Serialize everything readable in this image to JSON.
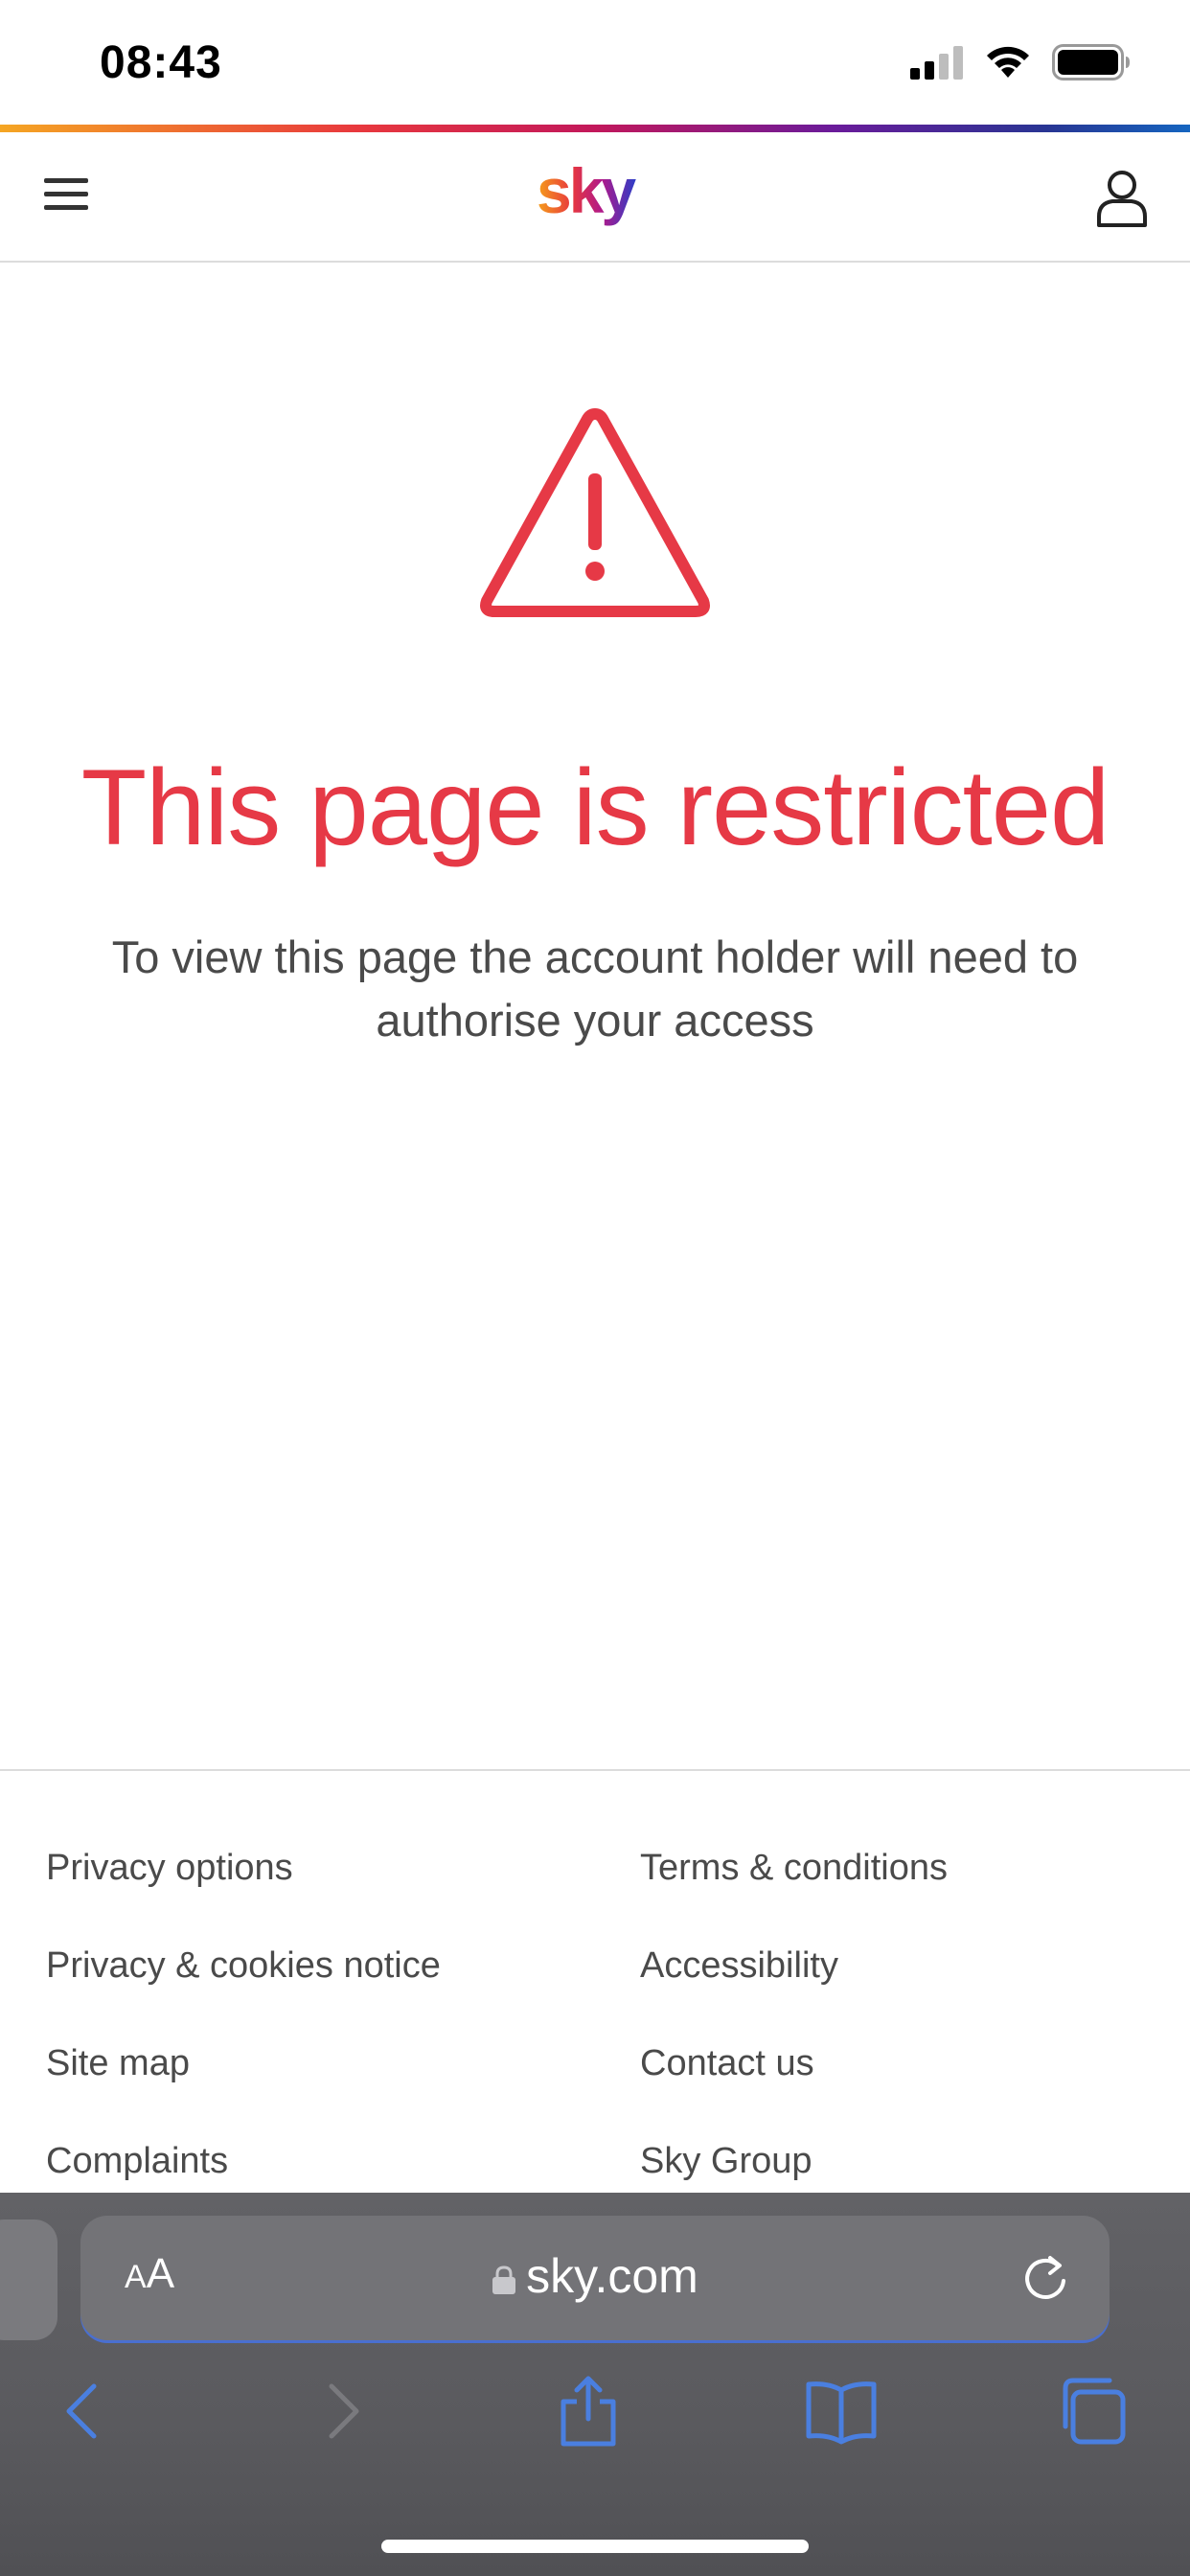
{
  "status_bar": {
    "time": "08:43"
  },
  "header": {
    "logo_text": "sky"
  },
  "main": {
    "title": "This page is restricted",
    "message": "To view this page the account holder will need to authorise your access"
  },
  "footer": {
    "left": [
      "Privacy options",
      "Privacy & cookies notice",
      "Site map",
      "Complaints"
    ],
    "right": [
      "Terms & conditions",
      "Accessibility",
      "Contact us",
      "Sky Group"
    ]
  },
  "browser": {
    "aa_small": "A",
    "aa_large": "A",
    "url": "sky.com"
  },
  "colors": {
    "accent_red": "#e63946",
    "ios_blue": "#4a7fe0"
  }
}
